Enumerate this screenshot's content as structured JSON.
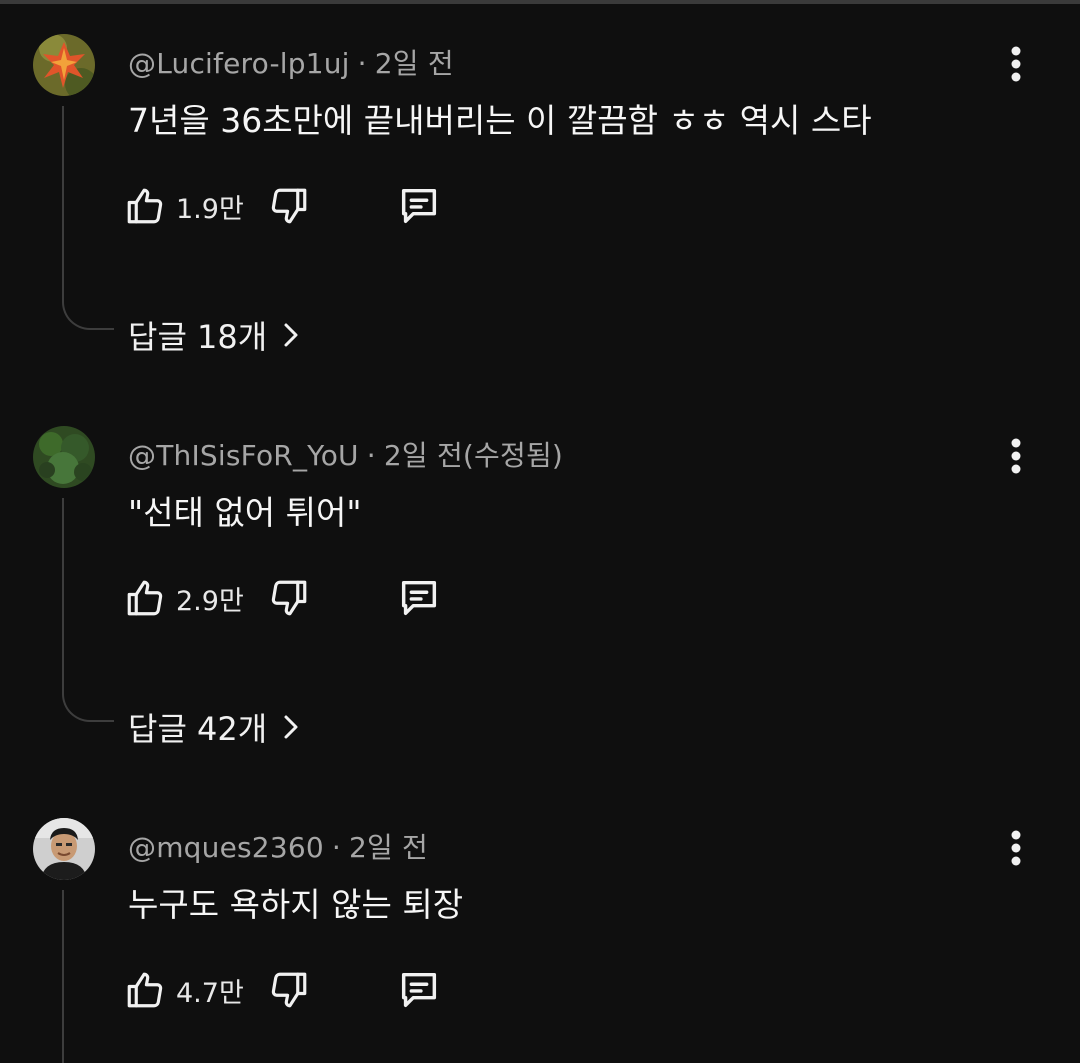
{
  "comments": [
    {
      "author": "@Lucifero-lp1uj",
      "separator": "·",
      "time": "2일 전",
      "text": "7년을 36초만에 끝내버리는 이 깔끔함 ㅎㅎ 역시 스타",
      "likes": "1.9만",
      "replies_label": "답글 18개",
      "avatar_icon": "autumn-leaf-avatar"
    },
    {
      "author": "@ThISisFoR_YoU",
      "separator": "·",
      "time": "2일 전(수정됨)",
      "text": "\"선태 없어 튀어\"",
      "likes": "2.9만",
      "replies_label": "답글 42개",
      "avatar_icon": "green-moss-avatar"
    },
    {
      "author": "@mques2360",
      "separator": "·",
      "time": "2일 전",
      "text": "누구도 욕하지 않는 퇴장",
      "likes": "4.7만",
      "avatar_icon": "person-photo-avatar"
    }
  ],
  "icons": {
    "like": "thumbs-up-icon",
    "dislike": "thumbs-down-icon",
    "reply": "comment-reply-icon",
    "more": "more-vertical-icon",
    "chevron": "chevron-right-icon"
  },
  "colors": {
    "background": "#0f0f0f",
    "meta_text": "#a6a6a6",
    "body_text": "#f6f6f6",
    "thread_line": "#3d3d3d"
  }
}
